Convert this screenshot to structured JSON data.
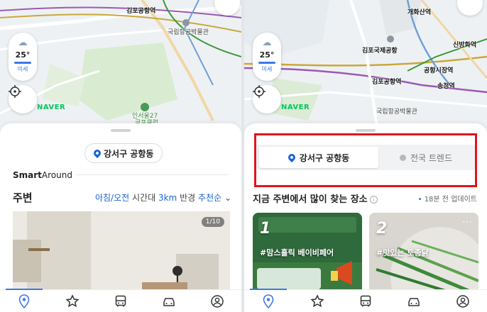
{
  "left_map": {
    "labels": {
      "airport_station": "김포공항역",
      "museum": "국립항공박물관",
      "area": "인서울27",
      "area2": "골프클럽"
    },
    "weather": {
      "temp": "25°",
      "dust": "미세"
    },
    "brand": "NAVER"
  },
  "right_map": {
    "labels": {
      "gaehwa": "개화산역",
      "airport": "김포국제공항",
      "sinbang": "신방화역",
      "airport_market": "공항시장역",
      "songjeong": "송정역",
      "airport_station": "김포공항역",
      "museum": "국립항공박물관"
    },
    "weather": {
      "temp": "25°",
      "dust": "미세"
    },
    "brand": "NAVER"
  },
  "left_sheet": {
    "location_chip": "강서구 공항동",
    "smart_bold": "Smart",
    "smart_rest": "Around",
    "near_title": "주변",
    "filter": {
      "time": "아침/오전",
      "time_suffix": "시간대",
      "radius": "3km",
      "radius_suffix": "반경",
      "sort": "추천순"
    },
    "photo_counter": "1/10"
  },
  "right_sheet": {
    "toggle_active": "강서구 공항동",
    "toggle_inactive": "전국 트렌드",
    "popular_title": "지금 주변에서 많이 찾는 장소",
    "info_icon": "i",
    "updated_time": "18분 전",
    "updated_suffix": "업데이트",
    "cards": [
      {
        "rank": "1",
        "tag": "#맘스홀릭 베이비페어"
      },
      {
        "rank": "2",
        "tag": "#맛있는 토종닭"
      }
    ]
  },
  "tabbar": {
    "icons": [
      "map-pin-icon",
      "star-icon",
      "bus-icon",
      "car-icon",
      "profile-icon"
    ]
  },
  "colors": {
    "accent": "#1a64d6",
    "naver_green": "#03c75a",
    "highlight_red": "#e0141c"
  }
}
